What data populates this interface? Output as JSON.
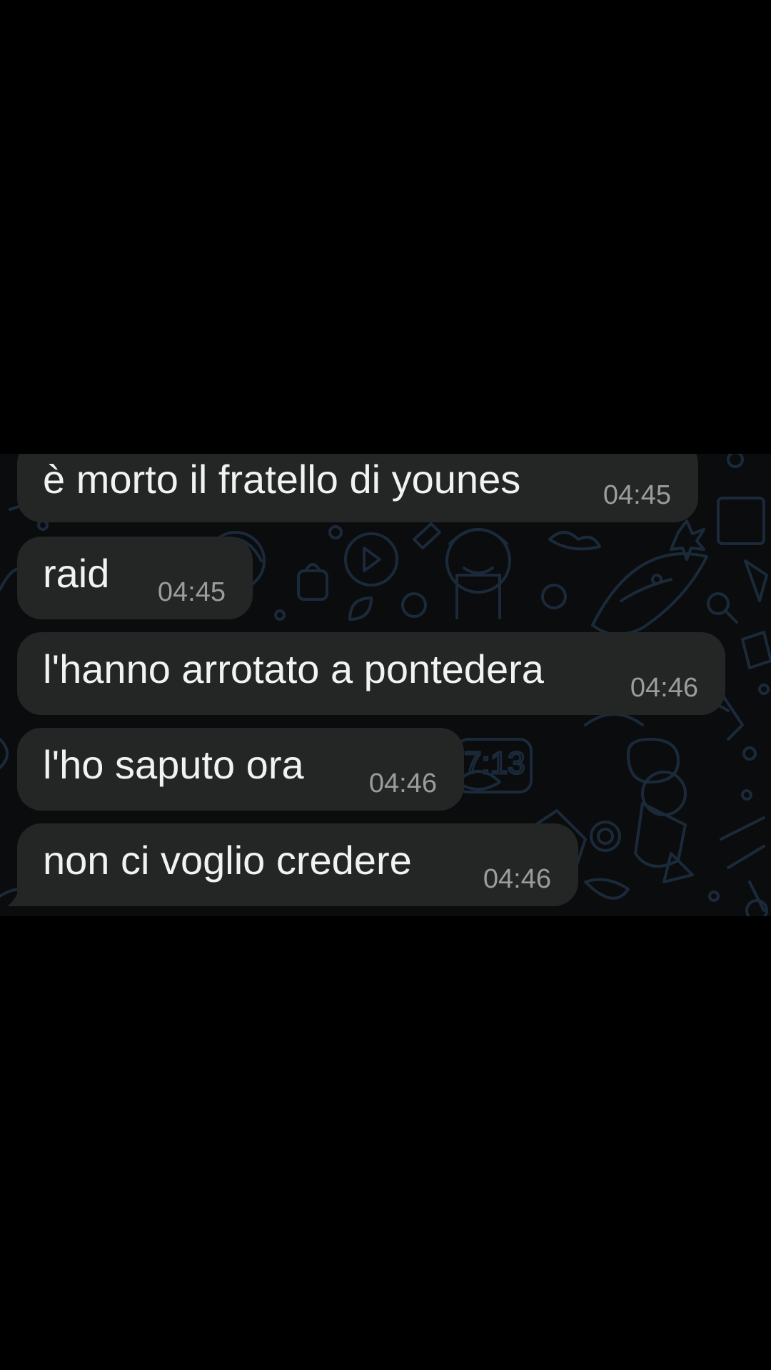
{
  "chat": {
    "messages": [
      {
        "text": "è morto il fratello di younes",
        "time": "04:45"
      },
      {
        "text": "raid",
        "time": "04:45"
      },
      {
        "text": "l'hanno arrotato a pontedera",
        "time": "04:46"
      },
      {
        "text": "l'ho saputo ora",
        "time": "04:46"
      },
      {
        "text": "non ci voglio credere",
        "time": "04:46"
      }
    ],
    "wallpaper_doodle_text": "7:13"
  },
  "colors": {
    "background": "#000000",
    "chat_background": "#0b0c0d",
    "bubble": "#242626",
    "message_text": "#f2f2f2",
    "timestamp": "#9a9c9e",
    "doodle": "#1b2a3a"
  },
  "icons": [
    "wallpaper-doodle-pattern",
    "bubble-tail-icon"
  ]
}
